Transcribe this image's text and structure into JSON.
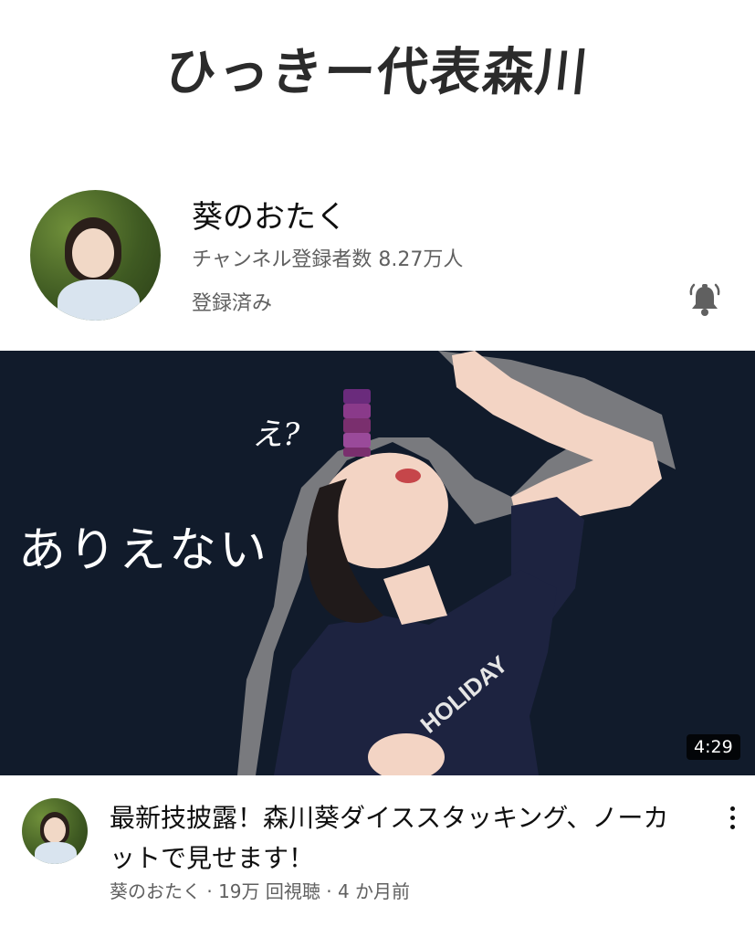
{
  "banner": {
    "title": "ひっきー代表森川"
  },
  "channel": {
    "name": "葵のおたく",
    "subscribers": "チャンネル登録者数 8.27万人",
    "subscribed_label": "登録済み",
    "bell_icon": "notification-bell-icon"
  },
  "thumbnail": {
    "caption_main": "ありえない",
    "caption_small": "え?",
    "duration": "4:29",
    "colors": {
      "background": "#111b2b",
      "shirt": "#1d2340",
      "skin": "#f3d4c4"
    }
  },
  "video": {
    "title": "最新技披露！森川葵ダイススタッキング、ノーカットで見せます！",
    "meta": "葵のおたく · 19万 回視聴 · 4 か月前",
    "more_icon": "more-vert-icon"
  }
}
